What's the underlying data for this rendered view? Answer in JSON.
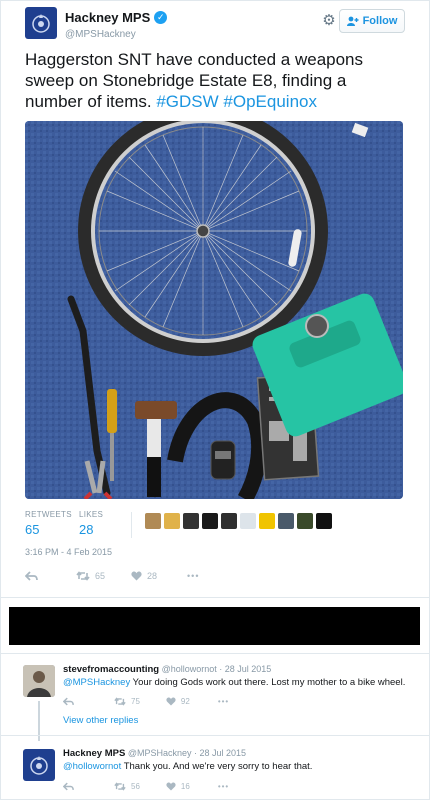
{
  "tweet": {
    "display_name": "Hackney MPS",
    "handle": "@MPSHackney",
    "follow_label": "Follow",
    "text_main": "Haggerston SNT have conducted a weapons sweep on Stonebridge Estate E8, finding a number of items. ",
    "hashtag_1": "#GDSW",
    "hashtag_2": "#OpEquinox",
    "retweets_label": "RETWEETS",
    "retweets_count": "65",
    "likes_label": "LIKES",
    "likes_count": "28",
    "timestamp": "3:16 PM - 4 Feb 2015",
    "action_retweet_count": "65",
    "action_like_count": "28",
    "more": "•••"
  },
  "replies": [
    {
      "name": "stevefromaccounting",
      "handle": "@hollowornot",
      "date": "· 28 Jul 2015",
      "mention": "@MPSHackney",
      "text": " Your doing Gods work out there. Lost my mother to a bike wheel.",
      "retweets": "75",
      "likes": "92",
      "more": "•••"
    },
    {
      "name": "Hackney MPS",
      "handle": "@MPSHackney",
      "date": "· 28 Jul 2015",
      "mention": "@hollowornot",
      "text": " Thank you. And we're very sorry to hear that.",
      "retweets": "56",
      "likes": "16",
      "more": "•••"
    }
  ],
  "view_other_replies": "View other replies",
  "icons": {
    "verified": "verified-badge-icon",
    "gear": "gear-icon",
    "follow": "add-user-icon",
    "reply": "reply-icon",
    "retweet": "retweet-icon",
    "like": "heart-icon"
  },
  "colors": {
    "link_blue": "#1b95e0",
    "meta_grey": "#8899a6",
    "brand_navy": "#1f3f8f"
  }
}
